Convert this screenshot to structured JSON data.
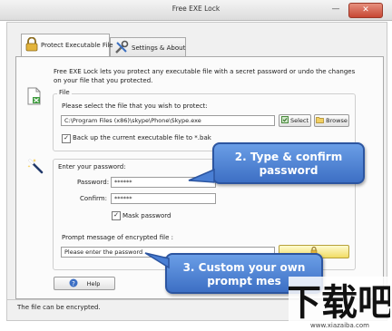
{
  "window": {
    "title": "Free EXE Lock",
    "minimize_glyph": "—",
    "close_glyph": "✕"
  },
  "tabs": [
    {
      "label": "Protect Executable File",
      "icon": "lock-icon",
      "active": true
    },
    {
      "label": "Settings & About",
      "icon": "tools-icon",
      "active": false
    }
  ],
  "description": "Free EXE Lock lets you protect any executable file with a secret password or undo the changes on your file that you protected.",
  "file_group": {
    "title": "File",
    "prompt": "Please select the file that you wish to protect:",
    "path_value": "C:\\Program Files (x86)\\skype\\Phone\\Skype.exe",
    "select_label": "Select",
    "browse_label": "Browse",
    "backup_label": "Back up the current executable file to *.bak",
    "backup_checked": true
  },
  "password_group": {
    "title": "Enter your password:",
    "password_label": "Password:",
    "password_value": "******",
    "confirm_label": "Confirm:",
    "confirm_value": "******",
    "mask_label": "Mask password",
    "mask_checked": true,
    "prompt_title": "Prompt message of encrypted file :",
    "prompt_value": "Please enter the password"
  },
  "callouts": {
    "confirm": "2. Type & confirm password",
    "prompt": "3. Custom your own prompt mes"
  },
  "help_label": "Help",
  "status": "The file can be encrypted.",
  "watermark": {
    "logo_text": "下载吧",
    "url": "www.xiazaiba.com"
  },
  "colors": {
    "callout": "#4a7fd4",
    "close_button": "#c74734",
    "lock_gold": "#e3b43b"
  }
}
